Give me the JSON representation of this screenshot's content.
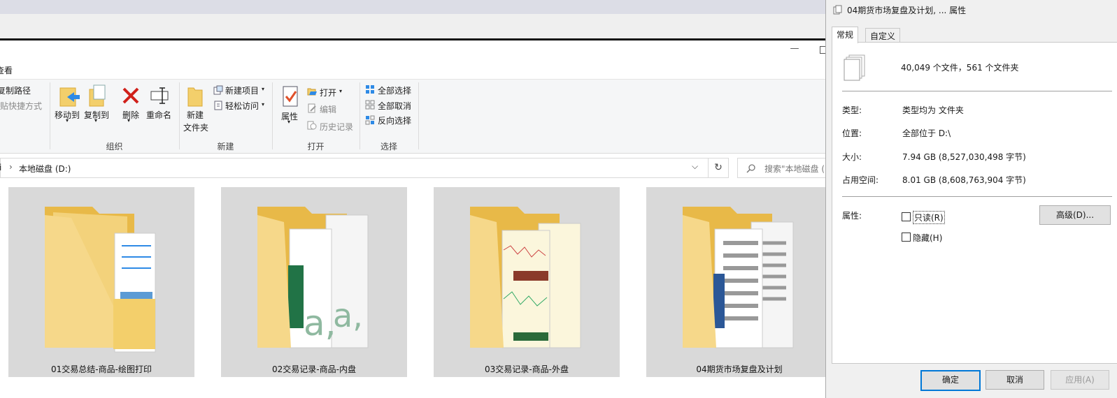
{
  "explorer": {
    "menu_view": "查看",
    "ribbon": {
      "copy_path": "复制路径",
      "paste_shortcut": "粘贴快捷方式",
      "move_to": "移动到",
      "copy_to": "复制到",
      "delete": "删除",
      "rename": "重命名",
      "new_folder_line1": "新建",
      "new_folder_line2": "文件夹",
      "new_item": "新建项目",
      "easy_access": "轻松访问",
      "properties": "属性",
      "open": "打开",
      "edit": "编辑",
      "history": "历史记录",
      "select_all": "全部选择",
      "select_none": "全部取消",
      "invert_selection": "反向选择",
      "groups": {
        "organize": "组织",
        "new": "新建",
        "open": "打开",
        "select": "选择"
      }
    },
    "address": {
      "prefix": "i",
      "sep": "›",
      "location": "本地磁盘 (D:)"
    },
    "search": {
      "placeholder": "搜索\"本地磁盘 (D:)\""
    },
    "folders": [
      {
        "name": "01交易总结-商品-绘图打印"
      },
      {
        "name": "02交易记录-商品-内盘"
      },
      {
        "name": "03交易记录-商品-外盘"
      },
      {
        "name": "04期货市场复盘及计划"
      }
    ]
  },
  "dialog": {
    "title": "04期货市场复盘及计划, ... 属性",
    "tabs": [
      "常规",
      "自定义"
    ],
    "summary": "40,049 个文件，561 个文件夹",
    "rows": [
      {
        "label": "类型:",
        "value": "类型均为 文件夹"
      },
      {
        "label": "位置:",
        "value": "全部位于 D:\\"
      },
      {
        "label": "大小:",
        "value": "7.94 GB (8,527,030,498 字节)"
      },
      {
        "label": "占用空间:",
        "value": "8.01 GB (8,608,763,904 字节)"
      }
    ],
    "attributes_label": "属性:",
    "readonly": "只读(R)",
    "hidden": "隐藏(H)",
    "advanced": "高级(D)...",
    "ok": "确定",
    "cancel": "取消",
    "apply": "应用(A)"
  },
  "colors": {
    "folder": "#f3cf6b",
    "folder_dark": "#e8b948",
    "accent": "#0078d7",
    "green_doc": "#217346"
  }
}
